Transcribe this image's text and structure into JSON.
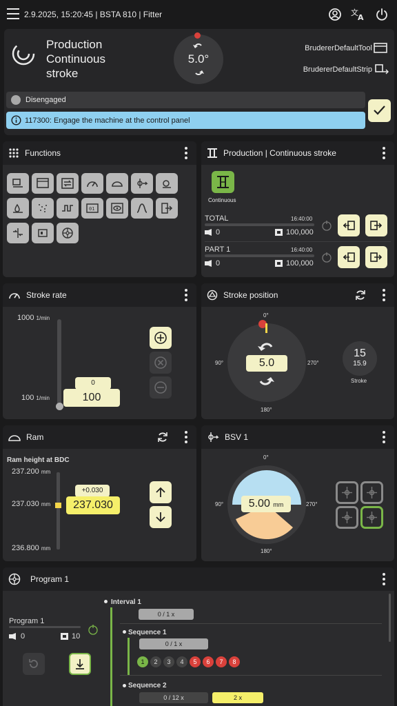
{
  "topbar": {
    "status_line": "2.9.2025, 15:20:45 | BSTA 810 | Fitter"
  },
  "header": {
    "title_line1": "Production",
    "title_line2": "Continuous",
    "title_line3": "stroke",
    "dial_value": "5.0°",
    "tool": "BrudererDefaultTool",
    "strip": "BrudererDefaultStrip"
  },
  "status": {
    "state": "Disengaged",
    "message": "117300:  Engage the machine at the control panel"
  },
  "functions": {
    "title": "Functions"
  },
  "production": {
    "title": "Production | Continuous stroke",
    "mode_label": "Continuous",
    "counters": [
      {
        "name": "TOTAL",
        "time": "16:40:00",
        "done": "0",
        "target": "100,000"
      },
      {
        "name": "PART 1",
        "time": "16:40:00",
        "done": "0",
        "target": "100,000"
      }
    ]
  },
  "stroke_rate": {
    "title": "Stroke rate",
    "max_value": "1000",
    "min_value": "100",
    "unit": "1/min",
    "setpoint": "0",
    "value": "100"
  },
  "stroke_position": {
    "title": "Stroke position",
    "deg_0": "0°",
    "deg_90": "90°",
    "deg_180": "180°",
    "deg_270": "270°",
    "value": "5.0",
    "stroke_count": "15",
    "stroke_sub": "15.9",
    "stroke_label": "Stroke"
  },
  "ram": {
    "title": "Ram",
    "subtitle": "Ram height at BDC",
    "max": "237.200",
    "mid": "237.030",
    "min": "236.800",
    "unit": "mm",
    "offset": "+0.030",
    "value": "237.030"
  },
  "bsv": {
    "title": "BSV 1",
    "deg_0": "0°",
    "deg_90": "90°",
    "deg_180": "180°",
    "deg_270": "270°",
    "value": "5.00",
    "unit": "mm"
  },
  "program": {
    "title": "Program 1",
    "name": "Program 1",
    "done": "0",
    "target": "10",
    "interval_title": "Interval 1",
    "interval_count": "0 / 1 x",
    "seq1_title": "Sequence 1",
    "seq1_count": "0 / 1 x",
    "steps": [
      "1",
      "2",
      "3",
      "4",
      "5",
      "6",
      "7",
      "8"
    ],
    "seq2_title": "Sequence 2",
    "seq2_count": "0 / 12 x",
    "seq2_badge": "2 x"
  },
  "colors": {
    "accent_yellow": "#f3f1c6",
    "accent_green": "#7ab648",
    "info_blue": "#8fd0f0",
    "alarm_red": "#d9413b"
  },
  "icons": [
    "menu-icon",
    "account-icon",
    "translate-icon",
    "power-icon",
    "logo-icon",
    "tool-icon",
    "strip-icon",
    "check-icon",
    "info-icon",
    "gauge-icon",
    "refresh-icon",
    "ram-icon",
    "bsv-icon",
    "program-icon"
  ]
}
